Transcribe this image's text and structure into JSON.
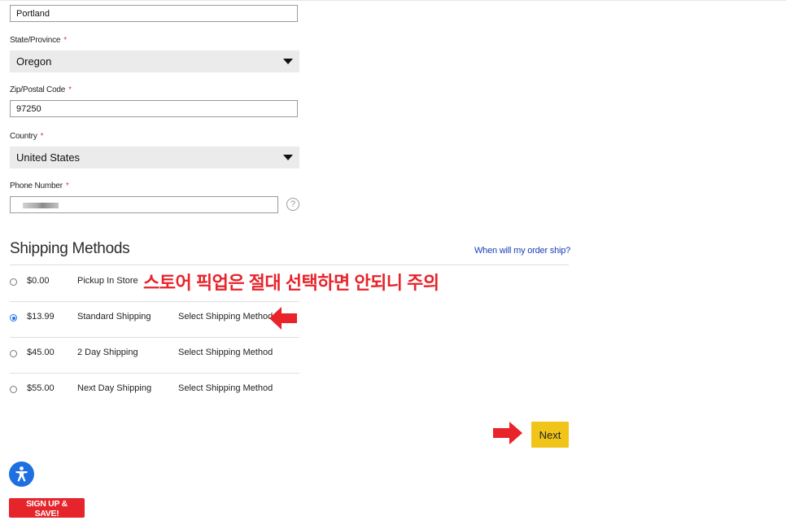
{
  "address": {
    "city_value": "Portland",
    "state_label": "State/Province",
    "state_value": "Oregon",
    "zip_label": "Zip/Postal Code",
    "zip_value": "97250",
    "country_label": "Country",
    "country_value": "United States",
    "phone_label": "Phone Number",
    "required_mark": "*",
    "help_symbol": "?"
  },
  "shipping": {
    "title": "Shipping Methods",
    "ship_link": "When will my order ship?",
    "methods": [
      {
        "price": "$0.00",
        "name": "Pickup In Store",
        "action": "",
        "selected": false
      },
      {
        "price": "$13.99",
        "name": "Standard Shipping",
        "action": "Select Shipping Method",
        "selected": true
      },
      {
        "price": "$45.00",
        "name": "2 Day Shipping",
        "action": "Select Shipping Method",
        "selected": false
      },
      {
        "price": "$55.00",
        "name": "Next Day Shipping",
        "action": "Select Shipping Method",
        "selected": false
      }
    ]
  },
  "annotation": {
    "warning_text": "스토어 픽업은 절대 선택하면 안되니 주의",
    "color": "#e8232a"
  },
  "buttons": {
    "next": "Next",
    "signup": "SIGN UP & SAVE!"
  },
  "colors": {
    "next_bg": "#f0c419",
    "signup_bg": "#e5242b",
    "accessibility_bg": "#1e6fe0",
    "link": "#1a3fb8"
  },
  "icons": {
    "select_caret": "chevron-down-icon",
    "help": "question-circle-icon",
    "arrow": "right-pointing-arrow-icon",
    "accessibility": "accessibility-person-icon"
  }
}
